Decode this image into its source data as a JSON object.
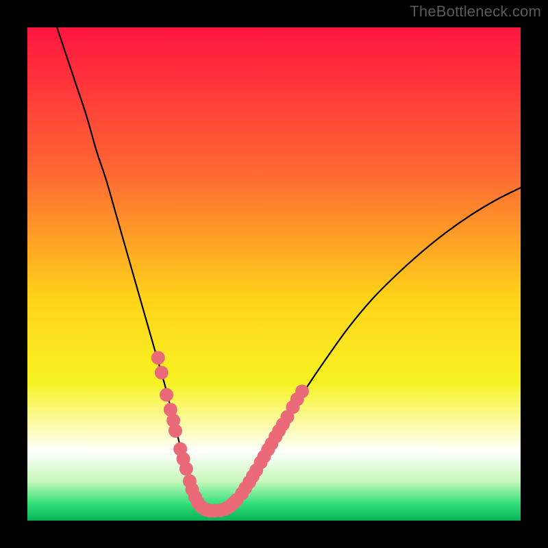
{
  "watermark": "TheBottleneck.com",
  "chart_data": {
    "type": "line",
    "title": "",
    "xlabel": "",
    "ylabel": "",
    "xlim": [
      0,
      100
    ],
    "ylim": [
      0,
      100
    ],
    "gradient_stops": [
      {
        "offset": 0.0,
        "color": "#ff153f"
      },
      {
        "offset": 0.3,
        "color": "#ff6a33"
      },
      {
        "offset": 0.55,
        "color": "#ffd31a"
      },
      {
        "offset": 0.72,
        "color": "#f7f323"
      },
      {
        "offset": 0.8,
        "color": "#fbfaa0"
      },
      {
        "offset": 0.86,
        "color": "#ffffff"
      },
      {
        "offset": 0.92,
        "color": "#c7f8bb"
      },
      {
        "offset": 0.965,
        "color": "#35e07a"
      },
      {
        "offset": 1.0,
        "color": "#06b255"
      }
    ],
    "series": [
      {
        "name": "bottleneck-curve",
        "x": [
          6,
          8,
          10,
          12,
          14,
          16,
          18,
          20,
          22,
          24,
          26,
          28,
          30,
          31,
          32,
          33,
          34,
          35,
          36,
          37,
          38,
          40,
          42,
          45,
          48,
          52,
          56,
          60,
          65,
          70,
          75,
          80,
          85,
          90,
          95,
          100
        ],
        "y": [
          100,
          94,
          88,
          82,
          75,
          69,
          62,
          55,
          48,
          41,
          34,
          27,
          19,
          15,
          11,
          8,
          5.5,
          3.8,
          2.6,
          2.0,
          2.0,
          2.3,
          3.5,
          7,
          12,
          19,
          26,
          32,
          39,
          45,
          50,
          54.5,
          58.5,
          62,
          65,
          67.5
        ]
      }
    ],
    "markers": {
      "color": "#ea6a7a",
      "radius": 10,
      "points": [
        {
          "x": 26.5,
          "y": 33
        },
        {
          "x": 27.2,
          "y": 30
        },
        {
          "x": 28.2,
          "y": 25.5
        },
        {
          "x": 29.0,
          "y": 22.5
        },
        {
          "x": 29.6,
          "y": 20.3
        },
        {
          "x": 30.0,
          "y": 18.2
        },
        {
          "x": 31.0,
          "y": 14.5
        },
        {
          "x": 31.6,
          "y": 12.5
        },
        {
          "x": 32.2,
          "y": 10.5
        },
        {
          "x": 32.9,
          "y": 8.0
        },
        {
          "x": 33.4,
          "y": 6.3
        },
        {
          "x": 34.0,
          "y": 4.8
        },
        {
          "x": 34.6,
          "y": 3.6
        },
        {
          "x": 35.4,
          "y": 2.7
        },
        {
          "x": 36.2,
          "y": 2.2
        },
        {
          "x": 37.0,
          "y": 2.0
        },
        {
          "x": 38.0,
          "y": 2.0
        },
        {
          "x": 39.2,
          "y": 2.1
        },
        {
          "x": 40.2,
          "y": 2.4
        },
        {
          "x": 41.0,
          "y": 2.9
        },
        {
          "x": 41.7,
          "y": 3.5
        },
        {
          "x": 42.4,
          "y": 4.2
        },
        {
          "x": 43.5,
          "y": 5.5
        },
        {
          "x": 44.2,
          "y": 6.6
        },
        {
          "x": 45.0,
          "y": 7.8
        },
        {
          "x": 45.7,
          "y": 9.0
        },
        {
          "x": 46.4,
          "y": 10.2
        },
        {
          "x": 47.3,
          "y": 11.8
        },
        {
          "x": 48.0,
          "y": 13.0
        },
        {
          "x": 48.8,
          "y": 14.4
        },
        {
          "x": 49.5,
          "y": 15.6
        },
        {
          "x": 50.3,
          "y": 17.0
        },
        {
          "x": 51.0,
          "y": 18.2
        },
        {
          "x": 51.8,
          "y": 19.5
        },
        {
          "x": 52.7,
          "y": 21.0
        },
        {
          "x": 53.8,
          "y": 23.0
        },
        {
          "x": 54.7,
          "y": 24.6
        },
        {
          "x": 55.7,
          "y": 26.2
        }
      ]
    }
  }
}
